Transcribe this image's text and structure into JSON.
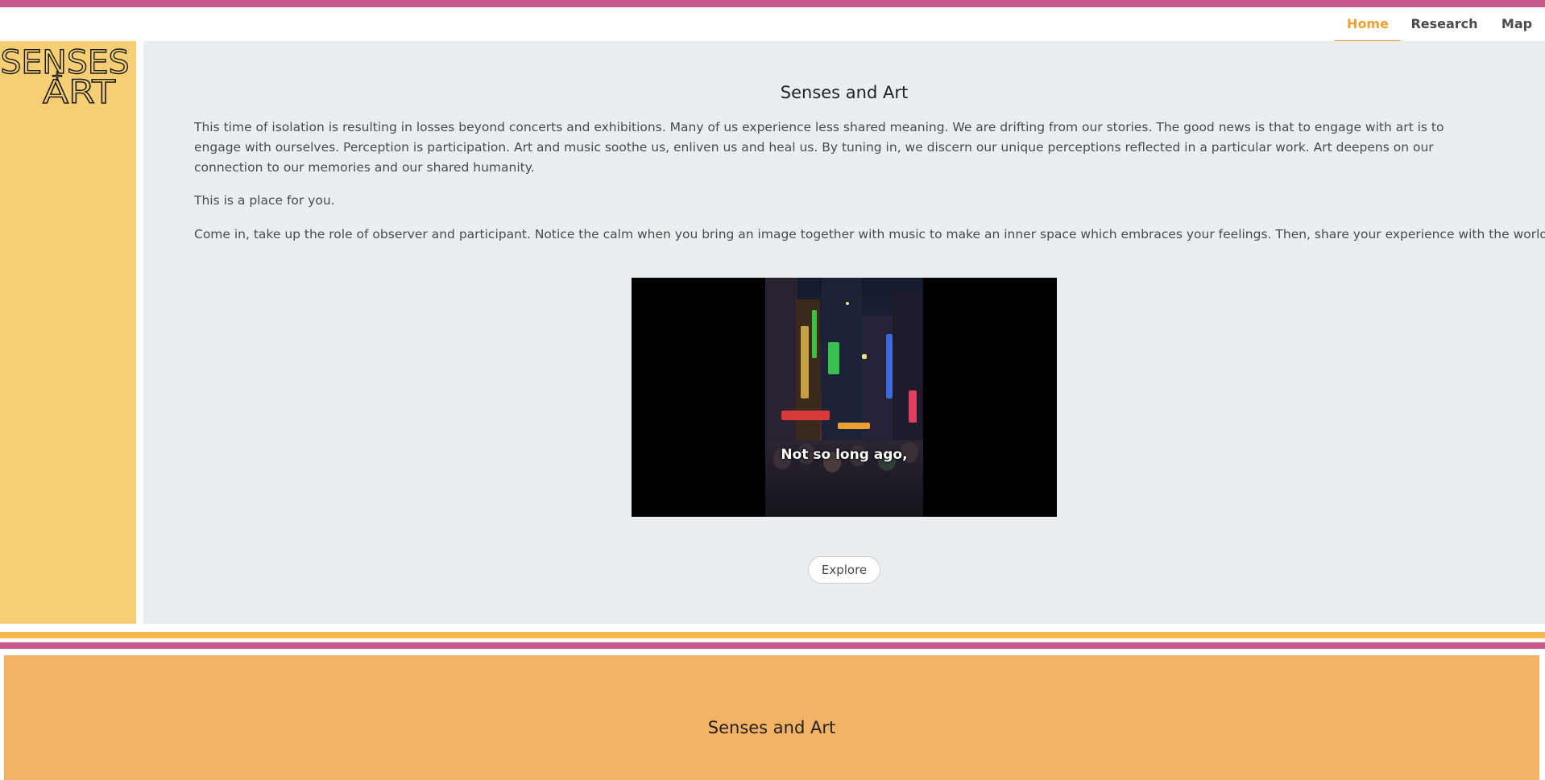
{
  "nav": {
    "items": [
      {
        "label": "Home",
        "active": true
      },
      {
        "label": "Research",
        "active": false
      },
      {
        "label": "Map",
        "active": false
      }
    ]
  },
  "logo": {
    "line1": "SENSES",
    "plus": "+",
    "line2": "ART"
  },
  "main": {
    "title": "Senses and Art",
    "paragraphs": [
      "This time of isolation is resulting in losses beyond concerts and exhibitions. Many of us experience less shared meaning. We are drifting from our stories. The good news is that to engage with art is to engage with ourselves. Perception is participation. Art and music soothe us, enliven us and heal us. By tuning in, we discern our unique perceptions reflected in a particular work. Art deepens on our connection to our memories and our shared humanity.",
      "This is a place for you.",
      "Come in, take up the role of observer and participant. Notice the calm when you bring an image together with music to make an inner space which embraces your feelings. Then, share your experience with the world."
    ],
    "video": {
      "caption": "Not so long ago,"
    },
    "explore_label": "Explore"
  },
  "footer": {
    "title": "Senses and Art"
  },
  "colors": {
    "accent_pink": "#c9598c",
    "accent_yellow": "#f2b84b",
    "sidebar": "#f6cf75",
    "footer": "#f3b266",
    "nav_active": "#f0a030"
  }
}
